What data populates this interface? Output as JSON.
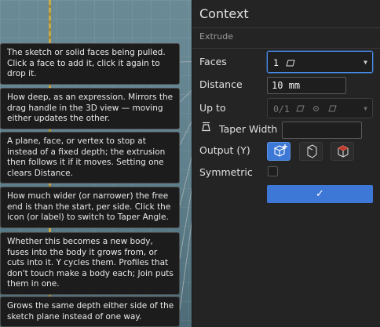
{
  "panel": {
    "title": "Context",
    "subtitle": "Extrude",
    "faces": {
      "label": "Faces",
      "value": "1",
      "icon": "face-icon"
    },
    "distance": {
      "label": "Distance",
      "value": "10 mm"
    },
    "up_to": {
      "label": "Up to",
      "value": "0/1",
      "icons": [
        "face-icon",
        "vertex-icon",
        "face-icon"
      ]
    },
    "taper": {
      "label": "Taper Width",
      "value": "",
      "icon": "taper-icon"
    },
    "output": {
      "label": "Output (Y)",
      "options": [
        {
          "name": "new-body",
          "selected": true
        },
        {
          "name": "join",
          "selected": false
        },
        {
          "name": "cut",
          "selected": false
        }
      ]
    },
    "symmetric": {
      "label": "Symmetric",
      "checked": false
    },
    "confirm_glyph": "✓"
  },
  "tooltips": [
    "The sketch or solid faces being pulled. Click a face to add it, click it again to drop it.",
    "How deep, as an expression. Mirrors the drag handle in the 3D view — moving either updates the other.",
    "A plane, face, or vertex to stop at instead of a fixed depth; the extrusion then follows it if it moves. Setting one clears Distance.",
    "How much wider (or narrower) the free end is than the start, per side. Click the icon (or label) to switch to Taper Angle.",
    "Whether this becomes a new body, fuses into the body it grows from, or cuts into it. Y cycles them. Profiles that don't touch make a body each; Join puts them in one.",
    "Grows the same depth either side of the sketch plane instead of one way."
  ],
  "colors": {
    "accent": "#3e78d6",
    "panel_bg": "#242424",
    "tooltip_bg": "#1c1c1c",
    "viewport": "#5f7f8c"
  }
}
